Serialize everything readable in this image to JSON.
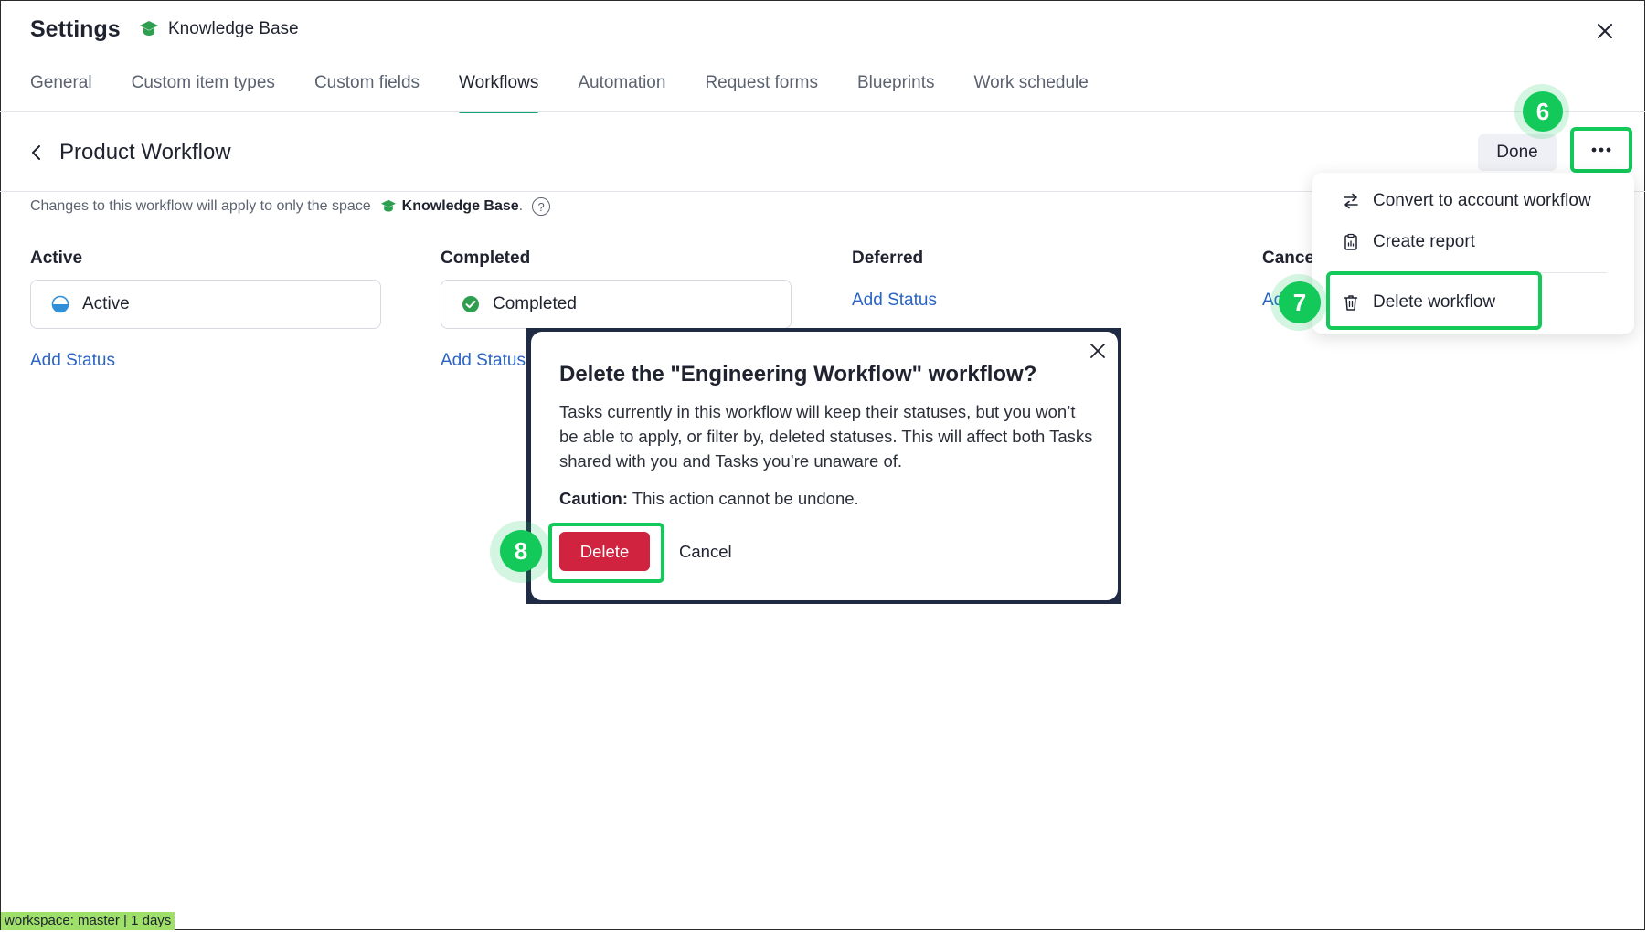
{
  "header": {
    "title": "Settings",
    "space_name": "Knowledge Base"
  },
  "tabs": [
    {
      "label": "General"
    },
    {
      "label": "Custom item types"
    },
    {
      "label": "Custom fields"
    },
    {
      "label": "Workflows",
      "active": true
    },
    {
      "label": "Automation"
    },
    {
      "label": "Request forms"
    },
    {
      "label": "Blueprints"
    },
    {
      "label": "Work schedule"
    }
  ],
  "workflow": {
    "title": "Product Workflow",
    "done_label": "Done",
    "info_prefix": "Changes to this workflow will apply to only the space",
    "info_space": "Knowledge Base",
    "info_suffix": ".",
    "help_glyph": "?"
  },
  "columns": [
    {
      "heading": "Active",
      "status": "Active",
      "add_label": "Add Status"
    },
    {
      "heading": "Completed",
      "status": "Completed",
      "add_label": "Add Status"
    },
    {
      "heading": "Deferred",
      "add_label": "Add Status"
    },
    {
      "heading": "Cance",
      "add_label": "Ad"
    }
  ],
  "menu": {
    "items": [
      {
        "label": "Convert to account workflow",
        "icon": "swap-arrows-icon"
      },
      {
        "label": "Create report",
        "icon": "report-clipboard-icon"
      },
      {
        "label": "Delete workflow",
        "icon": "trash-icon"
      }
    ]
  },
  "modal": {
    "title": "Delete the \"Engineering Workflow\" workflow?",
    "body": "Tasks currently in this workflow will keep their statuses, but you won’t be able to apply, or filter by, deleted statuses. This will affect both Tasks shared with you and Tasks you’re unaware of.",
    "caution_label": "Caution:",
    "caution_text": " This action cannot be undone.",
    "delete_label": "Delete",
    "cancel_label": "Cancel"
  },
  "steps": {
    "more": "6",
    "delete_workflow": "7",
    "delete_button": "8"
  },
  "footer": {
    "workspace_tag": "workspace: master | 1 days"
  },
  "colors": {
    "accent_green": "#12c95a",
    "tab_underline": "#1aa37a",
    "link_blue": "#2a64c5",
    "danger_red": "#d0233f",
    "space_icon_green": "#2e9e4f"
  }
}
